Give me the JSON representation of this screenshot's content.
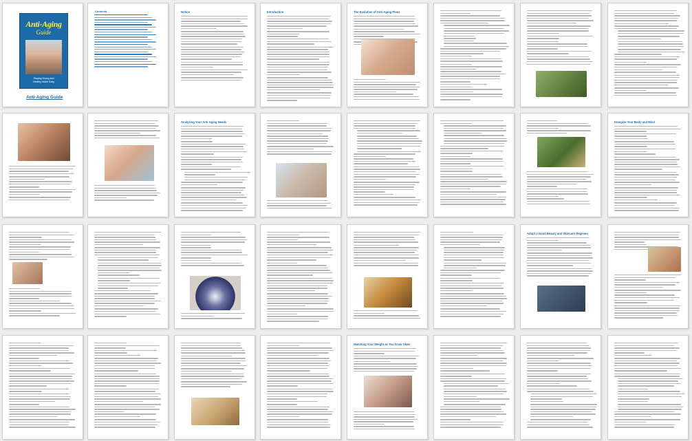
{
  "cover": {
    "title": "Anti-Aging",
    "subtitle": "Guide",
    "tagline_line1": "Staying Young and",
    "tagline_line2": "Healthy Made Easy",
    "link_text": "Anti-Aging Guide"
  },
  "toc": {
    "heading": "Contents"
  },
  "headings": {
    "p3": "Notice",
    "p4": "Introduction",
    "p5": "The Evolution of Anti-Aging Plans",
    "p7": "",
    "p8": "",
    "p10": "Analyzing Your Anti-Aging Needs",
    "p16": "Energize Your Body and Mind",
    "p25": "Adopt a Good Beauty and Skincare Regimen",
    "p32": "Watching Your Weight as You Grow Older"
  },
  "colors": {
    "accent": "#1f6aa6",
    "cover_bg": "#1e6aa8",
    "cover_title": "#ffe94a"
  }
}
